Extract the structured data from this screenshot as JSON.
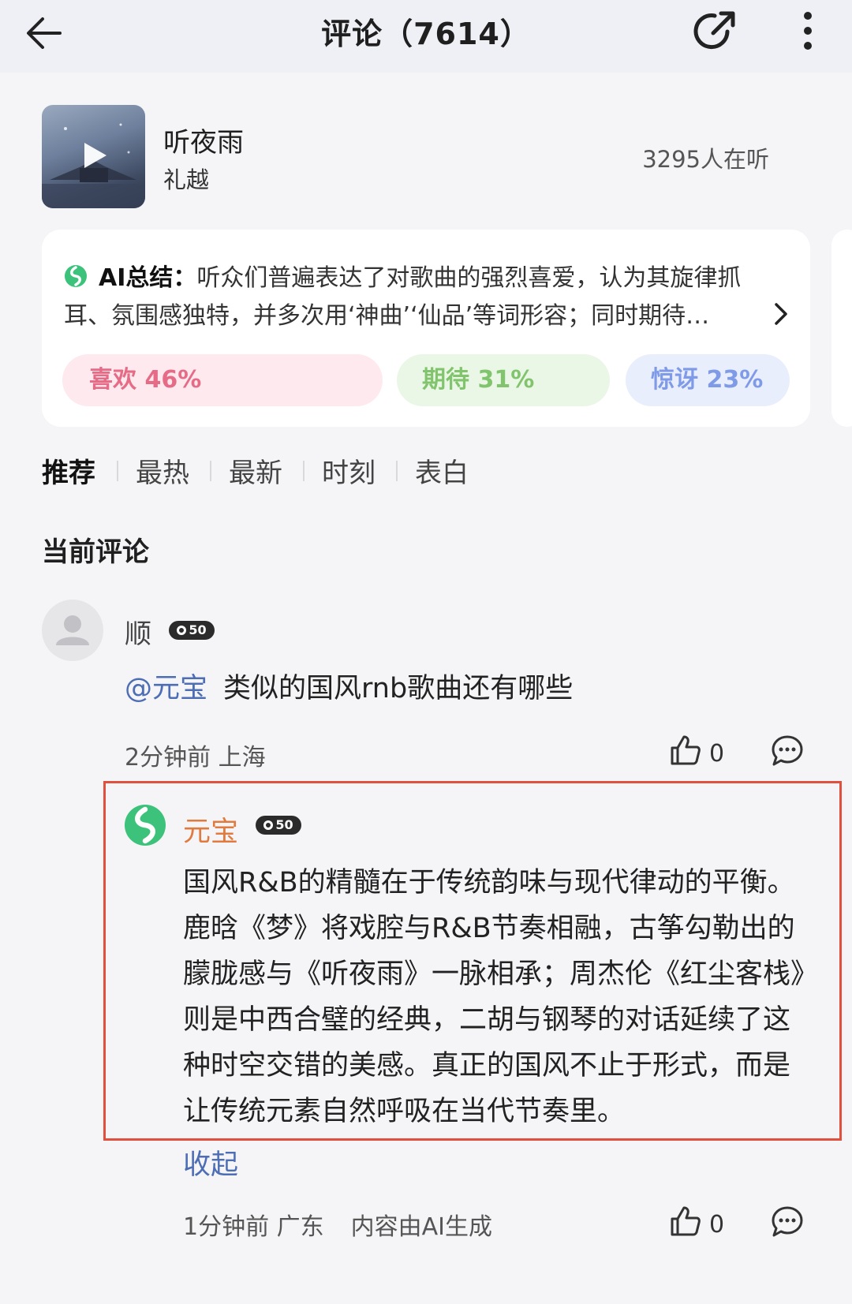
{
  "header": {
    "title": "评论（7614）",
    "back_icon": "arrow-left-icon",
    "share_icon": "share-icon",
    "more_icon": "more-vertical-icon"
  },
  "song": {
    "title": "听夜雨",
    "artist": "礼越",
    "listeners": "3295人在听"
  },
  "ai_summary": {
    "label": "AI总结：",
    "line1": "听众们普遍表达了对歌曲的强烈喜爱，认为其旋律抓",
    "line2": "耳、氛围感独特，并多次用‘神曲’‘仙品’等词形容；同时期待…",
    "sentiments": [
      {
        "label": "喜欢 46%",
        "percent": 46,
        "color": "#e56b86"
      },
      {
        "label": "期待 31%",
        "percent": 31,
        "color": "#82c46d"
      },
      {
        "label": "惊讶 23%",
        "percent": 23,
        "color": "#7f9ae6"
      }
    ]
  },
  "tabs": [
    {
      "label": "推荐",
      "active": true
    },
    {
      "label": "最热",
      "active": false
    },
    {
      "label": "最新",
      "active": false
    },
    {
      "label": "时刻",
      "active": false
    },
    {
      "label": "表白",
      "active": false
    }
  ],
  "section_title": "当前评论",
  "comment": {
    "user": "顺",
    "badge": "50",
    "mention": "@元宝",
    "text": "类似的国风rnb歌曲还有哪些",
    "time": "2分钟前",
    "location": "上海",
    "likes": "0"
  },
  "reply": {
    "user": "元宝",
    "badge": "50",
    "text": "国风R&B的精髓在于传统韵味与现代律动的平衡。鹿晗《梦》将戏腔与R&B节奏相融，古筝勾勒出的朦胧感与《听夜雨》一脉相承；周杰伦《红尘客栈》则是中西合璧的经典，二胡与钢琴的对话延续了这种时空交错的美感。真正的国风不止于形式，而是让传统元素自然呼吸在当代节奏里。",
    "collapse": "收起",
    "time": "1分钟前",
    "location": "广东",
    "ai_note": "内容由AI生成",
    "likes": "0"
  },
  "colors": {
    "accent_link": "#4d6db5",
    "yuanbao_name": "#e07a3e",
    "highlight_border": "#e0503c"
  }
}
